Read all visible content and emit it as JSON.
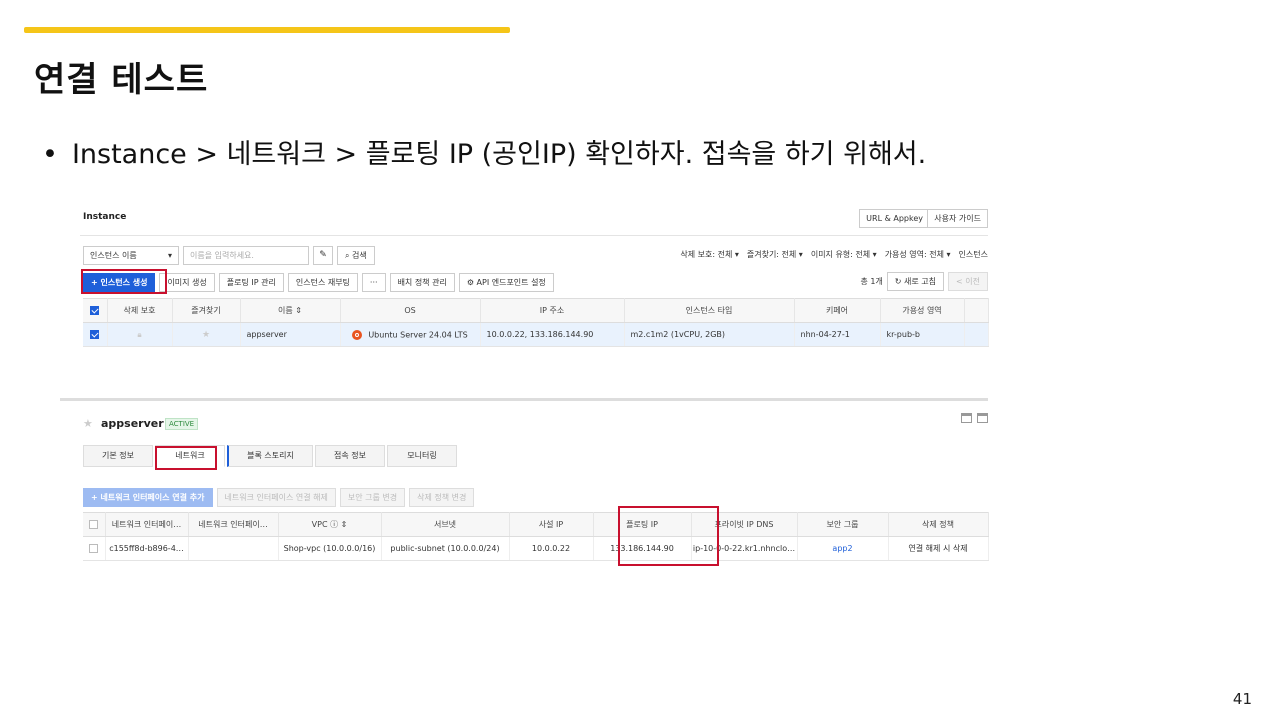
{
  "slide": {
    "title": "연결 테스트",
    "bullet": "Instance > 네트워크 > 플로팅 IP (공인IP) 확인하자.  접속을 하기 위해서.",
    "page_number": "41",
    "accent_color": "#f5c518"
  },
  "screenshot1": {
    "header_title": "Instance",
    "top_buttons": [
      "URL & Appkey",
      "사용자 가이드"
    ],
    "search": {
      "select_value": "인스턴스 이름",
      "placeholder": "이름을 입력하세요.",
      "search_label": "검색"
    },
    "filters": [
      "삭제 보호: 전체 ▾",
      "즐겨찾기: 전체 ▾",
      "이미지 유형: 전체 ▾",
      "가용성 영역: 전체 ▾",
      "인스턴스"
    ],
    "actions": [
      "+ 인스턴스 생성",
      "이미지 생성",
      "플로팅 IP 관리",
      "인스턴스 재부팅",
      "···",
      "배치 정책 관리",
      "API 엔드포인트 설정"
    ],
    "count_label": "총 1개",
    "refresh_label": "새로 고침",
    "prev_label": "< 이전",
    "table": {
      "headers": [
        "삭제 보호",
        "즐겨찾기",
        "이름 ⇕",
        "OS",
        "IP 주소",
        "인스턴스 타입",
        "키페어",
        "가용성 영역"
      ],
      "rows": [
        {
          "name": "appserver",
          "os": "Ubuntu Server 24.04 LTS",
          "ip": "10.0.0.22, 133.186.144.90",
          "type": "m2.c1m2 (1vCPU, 2GB)",
          "keypair": "nhn-04-27-1",
          "zone": "kr-pub-b"
        }
      ]
    }
  },
  "screenshot2": {
    "instance_name": "appserver",
    "status": "ACTIVE",
    "tabs": [
      "기본 정보",
      "네트워크",
      "블록 스토리지",
      "접속 정보",
      "모니터링"
    ],
    "active_tab": "네트워크",
    "buttons": [
      "+ 네트워크 인터페이스 연결 추가",
      "네트워크 인터페이스 연결 해제",
      "보안 그룹 변경",
      "삭제 정책 변경"
    ],
    "table": {
      "headers": [
        "네트워크 인터페이…",
        "네트워크 인터페이…",
        "VPC ⓘ ⇕",
        "서브넷",
        "사설 IP",
        "플로팅 IP",
        "프라이빗 IP DNS",
        "보안 그룹",
        "삭제 정책"
      ],
      "rows": [
        {
          "interface_id": "c155ff8d-b896-4…",
          "interface_name": "",
          "vpc": "Shop-vpc (10.0.0.0/16)",
          "subnet": "public-subnet (10.0.0.0/24)",
          "private_ip": "10.0.0.22",
          "floating_ip": "133.186.144.90",
          "private_dns": "ip-10-0-0-22.kr1.nhnclo…",
          "security_group": "app2",
          "delete_policy": "연결 해제 시 삭제"
        }
      ]
    }
  }
}
